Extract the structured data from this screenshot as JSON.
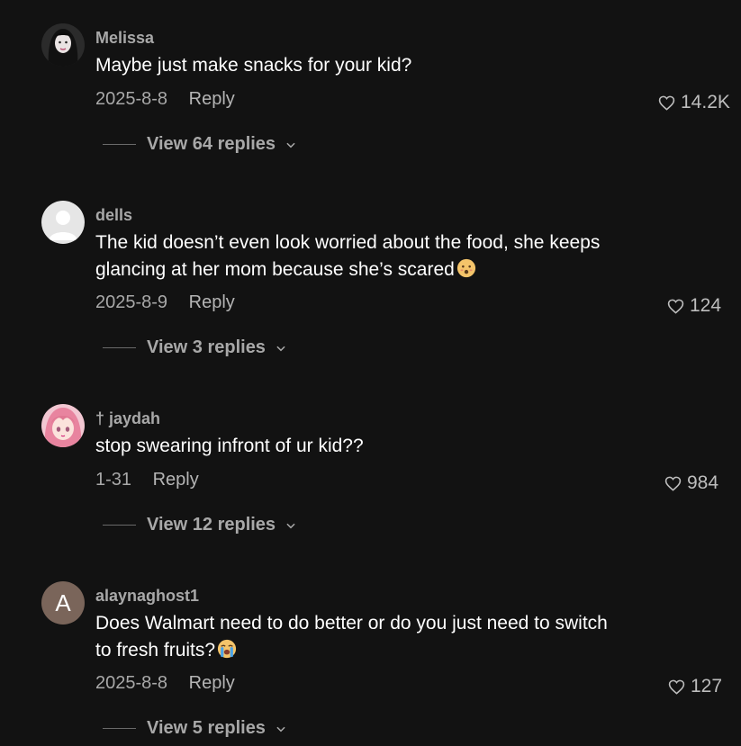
{
  "comments": [
    {
      "username": "Melissa",
      "text": "Maybe just make snacks for your kid?",
      "date": "2025-8-8",
      "reply_label": "Reply",
      "likes": "14.2K",
      "view_replies": "View 64 replies"
    },
    {
      "username": "dells",
      "text": "The kid doesn’t even look worried about the food, she keeps glancing at her mom because she’s scared",
      "emoji": "sad-face-emoji",
      "date": "2025-8-9",
      "reply_label": "Reply",
      "likes": "124",
      "view_replies": "View 3 replies"
    },
    {
      "username": "† jaydah",
      "text": "stop swearing infront of ur kid??",
      "date": "1-31",
      "reply_label": "Reply",
      "likes": "984",
      "view_replies": "View 12 replies"
    },
    {
      "username": "alaynaghost1",
      "avatar_letter": "A",
      "text": "Does Walmart need to do better or do you just need to switch to fresh fruits?",
      "emoji": "crying-face-emoji",
      "date": "2025-8-8",
      "reply_label": "Reply",
      "likes": "127",
      "view_replies": "View 5 replies"
    }
  ],
  "colors": {
    "background": "#121212",
    "username": "#a8a8a8",
    "text": "#ffffff",
    "meta": "#a8a8a8",
    "avatar_letter_bg": "#7a655a"
  }
}
